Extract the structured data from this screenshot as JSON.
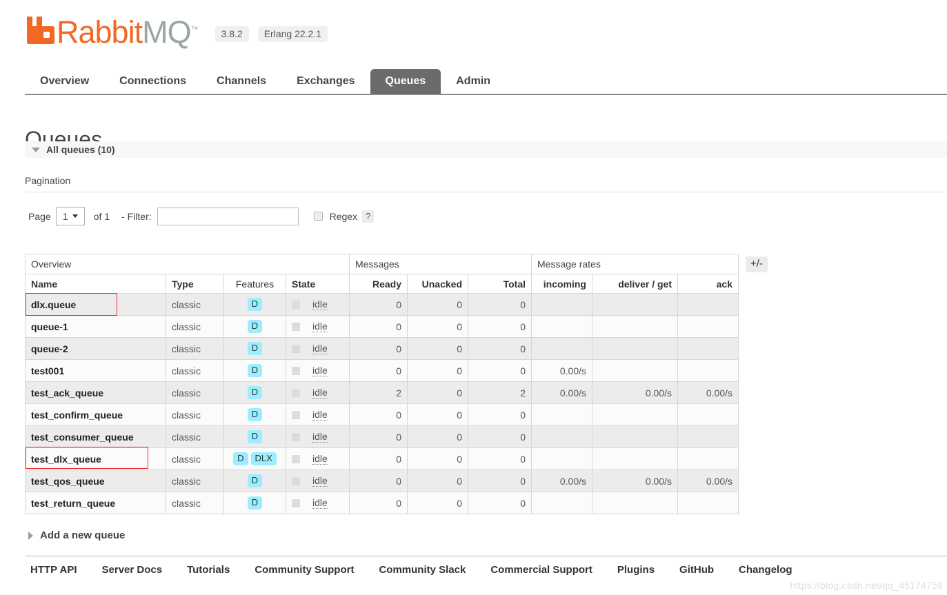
{
  "brand": {
    "name_part1": "Rabbit",
    "name_part2": "MQ",
    "trademark": "™",
    "version": "3.8.2",
    "erlang": "Erlang 22.2.1"
  },
  "nav": {
    "tabs": [
      {
        "label": "Overview",
        "active": false
      },
      {
        "label": "Connections",
        "active": false
      },
      {
        "label": "Channels",
        "active": false
      },
      {
        "label": "Exchanges",
        "active": false
      },
      {
        "label": "Queues",
        "active": true
      },
      {
        "label": "Admin",
        "active": false
      }
    ]
  },
  "page": {
    "title": "Queues",
    "section_label": "All queues (10)"
  },
  "pagination": {
    "title": "Pagination",
    "page_label": "Page",
    "page_value": "1",
    "of_label": "of 1",
    "filter_label": "- Filter:",
    "filter_value": "",
    "filter_placeholder": "",
    "regex_label": "Regex",
    "help_label": "?",
    "toggle_columns_label": "+/-"
  },
  "table": {
    "group_headers": [
      {
        "label": "Overview",
        "span": 4
      },
      {
        "label": "Messages",
        "span": 3
      },
      {
        "label": "Message rates",
        "span": 3
      }
    ],
    "columns": [
      {
        "label": "Name",
        "align": "left",
        "bold": true
      },
      {
        "label": "Type",
        "align": "left",
        "bold": true
      },
      {
        "label": "Features",
        "align": "center",
        "bold": false
      },
      {
        "label": "State",
        "align": "left",
        "bold": true
      },
      {
        "label": "Ready",
        "align": "right",
        "bold": true
      },
      {
        "label": "Unacked",
        "align": "right",
        "bold": true
      },
      {
        "label": "Total",
        "align": "right",
        "bold": true
      },
      {
        "label": "incoming",
        "align": "right",
        "bold": true
      },
      {
        "label": "deliver / get",
        "align": "right",
        "bold": true
      },
      {
        "label": "ack",
        "align": "right",
        "bold": true
      }
    ],
    "rows": [
      {
        "name": "dlx.queue",
        "type": "classic",
        "features": [
          "D"
        ],
        "state": "idle",
        "ready": "0",
        "unacked": "0",
        "total": "0",
        "incoming": "",
        "deliver_get": "",
        "ack": "",
        "highlighted": true
      },
      {
        "name": "queue-1",
        "type": "classic",
        "features": [
          "D"
        ],
        "state": "idle",
        "ready": "0",
        "unacked": "0",
        "total": "0",
        "incoming": "",
        "deliver_get": "",
        "ack": "",
        "highlighted": false
      },
      {
        "name": "queue-2",
        "type": "classic",
        "features": [
          "D"
        ],
        "state": "idle",
        "ready": "0",
        "unacked": "0",
        "total": "0",
        "incoming": "",
        "deliver_get": "",
        "ack": "",
        "highlighted": false
      },
      {
        "name": "test001",
        "type": "classic",
        "features": [
          "D"
        ],
        "state": "idle",
        "ready": "0",
        "unacked": "0",
        "total": "0",
        "incoming": "0.00/s",
        "deliver_get": "",
        "ack": "",
        "highlighted": false
      },
      {
        "name": "test_ack_queue",
        "type": "classic",
        "features": [
          "D"
        ],
        "state": "idle",
        "ready": "2",
        "unacked": "0",
        "total": "2",
        "incoming": "0.00/s",
        "deliver_get": "0.00/s",
        "ack": "0.00/s",
        "highlighted": false
      },
      {
        "name": "test_confirm_queue",
        "type": "classic",
        "features": [
          "D"
        ],
        "state": "idle",
        "ready": "0",
        "unacked": "0",
        "total": "0",
        "incoming": "",
        "deliver_get": "",
        "ack": "",
        "highlighted": false
      },
      {
        "name": "test_consumer_queue",
        "type": "classic",
        "features": [
          "D"
        ],
        "state": "idle",
        "ready": "0",
        "unacked": "0",
        "total": "0",
        "incoming": "",
        "deliver_get": "",
        "ack": "",
        "highlighted": false
      },
      {
        "name": "test_dlx_queue",
        "type": "classic",
        "features": [
          "D",
          "DLX"
        ],
        "state": "idle",
        "ready": "0",
        "unacked": "0",
        "total": "0",
        "incoming": "",
        "deliver_get": "",
        "ack": "",
        "highlighted": true
      },
      {
        "name": "test_qos_queue",
        "type": "classic",
        "features": [
          "D"
        ],
        "state": "idle",
        "ready": "0",
        "unacked": "0",
        "total": "0",
        "incoming": "0.00/s",
        "deliver_get": "0.00/s",
        "ack": "0.00/s",
        "highlighted": false
      },
      {
        "name": "test_return_queue",
        "type": "classic",
        "features": [
          "D"
        ],
        "state": "idle",
        "ready": "0",
        "unacked": "0",
        "total": "0",
        "incoming": "",
        "deliver_get": "",
        "ack": "",
        "highlighted": false
      }
    ]
  },
  "add_queue": {
    "label": "Add a new queue"
  },
  "footer": {
    "links": [
      "HTTP API",
      "Server Docs",
      "Tutorials",
      "Community Support",
      "Community Slack",
      "Commercial Support",
      "Plugins",
      "GitHub",
      "Changelog"
    ]
  },
  "watermark": {
    "text": "https://blog.csdn.net/qq_45174759"
  },
  "colors": {
    "brand_orange": "#f26724",
    "brand_gray": "#9aa6a0",
    "active_tab": "#6b6b6b",
    "badge_cyan": "#9beeff",
    "annotation_red": "#ee2b2b"
  }
}
